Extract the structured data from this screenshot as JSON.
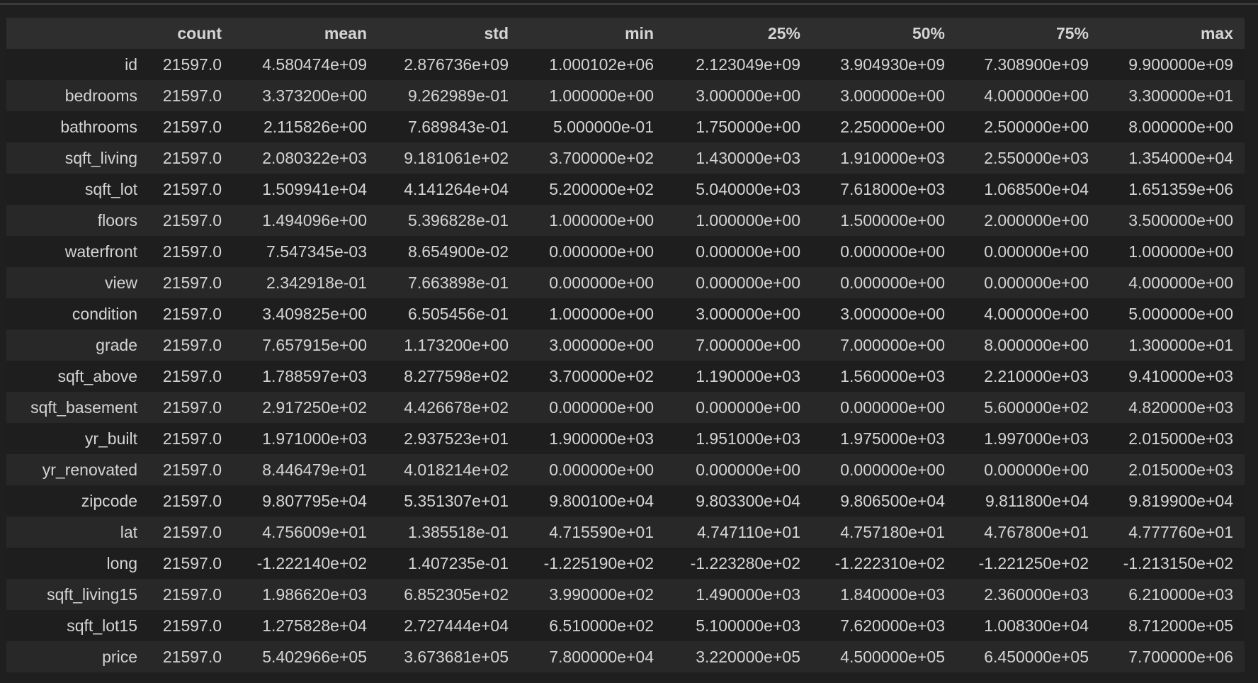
{
  "table": {
    "columns": [
      "",
      "count",
      "mean",
      "std",
      "min",
      "25%",
      "50%",
      "75%",
      "max"
    ],
    "rows": [
      [
        "id",
        "21597.0",
        "4.580474e+09",
        "2.876736e+09",
        "1.000102e+06",
        "2.123049e+09",
        "3.904930e+09",
        "7.308900e+09",
        "9.900000e+09"
      ],
      [
        "bedrooms",
        "21597.0",
        "3.373200e+00",
        "9.262989e-01",
        "1.000000e+00",
        "3.000000e+00",
        "3.000000e+00",
        "4.000000e+00",
        "3.300000e+01"
      ],
      [
        "bathrooms",
        "21597.0",
        "2.115826e+00",
        "7.689843e-01",
        "5.000000e-01",
        "1.750000e+00",
        "2.250000e+00",
        "2.500000e+00",
        "8.000000e+00"
      ],
      [
        "sqft_living",
        "21597.0",
        "2.080322e+03",
        "9.181061e+02",
        "3.700000e+02",
        "1.430000e+03",
        "1.910000e+03",
        "2.550000e+03",
        "1.354000e+04"
      ],
      [
        "sqft_lot",
        "21597.0",
        "1.509941e+04",
        "4.141264e+04",
        "5.200000e+02",
        "5.040000e+03",
        "7.618000e+03",
        "1.068500e+04",
        "1.651359e+06"
      ],
      [
        "floors",
        "21597.0",
        "1.494096e+00",
        "5.396828e-01",
        "1.000000e+00",
        "1.000000e+00",
        "1.500000e+00",
        "2.000000e+00",
        "3.500000e+00"
      ],
      [
        "waterfront",
        "21597.0",
        "7.547345e-03",
        "8.654900e-02",
        "0.000000e+00",
        "0.000000e+00",
        "0.000000e+00",
        "0.000000e+00",
        "1.000000e+00"
      ],
      [
        "view",
        "21597.0",
        "2.342918e-01",
        "7.663898e-01",
        "0.000000e+00",
        "0.000000e+00",
        "0.000000e+00",
        "0.000000e+00",
        "4.000000e+00"
      ],
      [
        "condition",
        "21597.0",
        "3.409825e+00",
        "6.505456e-01",
        "1.000000e+00",
        "3.000000e+00",
        "3.000000e+00",
        "4.000000e+00",
        "5.000000e+00"
      ],
      [
        "grade",
        "21597.0",
        "7.657915e+00",
        "1.173200e+00",
        "3.000000e+00",
        "7.000000e+00",
        "7.000000e+00",
        "8.000000e+00",
        "1.300000e+01"
      ],
      [
        "sqft_above",
        "21597.0",
        "1.788597e+03",
        "8.277598e+02",
        "3.700000e+02",
        "1.190000e+03",
        "1.560000e+03",
        "2.210000e+03",
        "9.410000e+03"
      ],
      [
        "sqft_basement",
        "21597.0",
        "2.917250e+02",
        "4.426678e+02",
        "0.000000e+00",
        "0.000000e+00",
        "0.000000e+00",
        "5.600000e+02",
        "4.820000e+03"
      ],
      [
        "yr_built",
        "21597.0",
        "1.971000e+03",
        "2.937523e+01",
        "1.900000e+03",
        "1.951000e+03",
        "1.975000e+03",
        "1.997000e+03",
        "2.015000e+03"
      ],
      [
        "yr_renovated",
        "21597.0",
        "8.446479e+01",
        "4.018214e+02",
        "0.000000e+00",
        "0.000000e+00",
        "0.000000e+00",
        "0.000000e+00",
        "2.015000e+03"
      ],
      [
        "zipcode",
        "21597.0",
        "9.807795e+04",
        "5.351307e+01",
        "9.800100e+04",
        "9.803300e+04",
        "9.806500e+04",
        "9.811800e+04",
        "9.819900e+04"
      ],
      [
        "lat",
        "21597.0",
        "4.756009e+01",
        "1.385518e-01",
        "4.715590e+01",
        "4.747110e+01",
        "4.757180e+01",
        "4.767800e+01",
        "4.777760e+01"
      ],
      [
        "long",
        "21597.0",
        "-1.222140e+02",
        "1.407235e-01",
        "-1.225190e+02",
        "-1.223280e+02",
        "-1.222310e+02",
        "-1.221250e+02",
        "-1.213150e+02"
      ],
      [
        "sqft_living15",
        "21597.0",
        "1.986620e+03",
        "6.852305e+02",
        "3.990000e+02",
        "1.490000e+03",
        "1.840000e+03",
        "2.360000e+03",
        "6.210000e+03"
      ],
      [
        "sqft_lot15",
        "21597.0",
        "1.275828e+04",
        "2.727444e+04",
        "6.510000e+02",
        "5.100000e+03",
        "7.620000e+03",
        "1.008300e+04",
        "8.712000e+05"
      ],
      [
        "price",
        "21597.0",
        "5.402966e+05",
        "3.673681e+05",
        "7.800000e+04",
        "3.220000e+05",
        "4.500000e+05",
        "6.450000e+05",
        "7.700000e+06"
      ]
    ]
  }
}
